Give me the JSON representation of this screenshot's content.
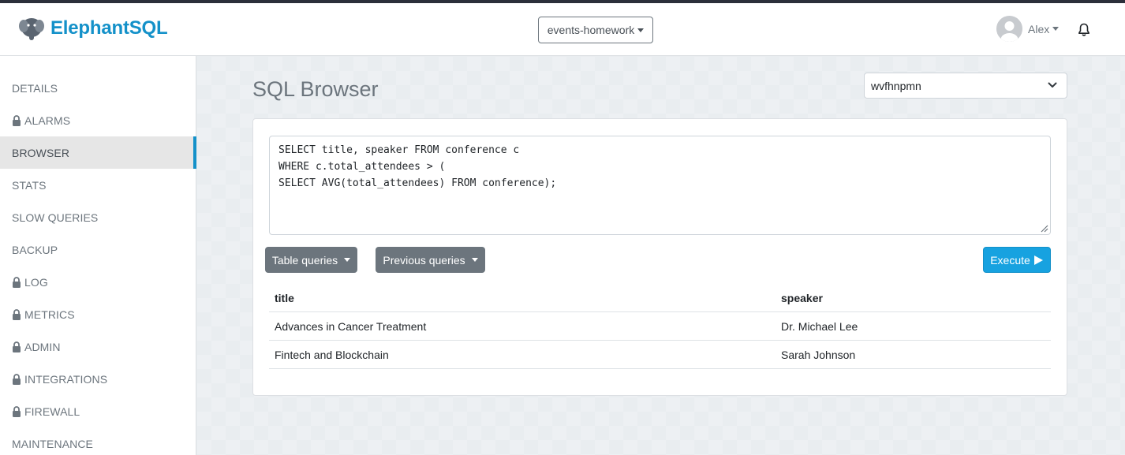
{
  "brand": {
    "name": "ElephantSQL"
  },
  "header": {
    "instance": "events-homework",
    "user": "Alex",
    "icons": [
      "elephant-logo-icon",
      "avatar-icon",
      "bell-icon"
    ]
  },
  "sidebar": {
    "items": [
      {
        "label": "DETAILS",
        "locked": false,
        "active": false
      },
      {
        "label": "ALARMS",
        "locked": true,
        "active": false
      },
      {
        "label": "BROWSER",
        "locked": false,
        "active": true
      },
      {
        "label": "STATS",
        "locked": false,
        "active": false
      },
      {
        "label": "SLOW QUERIES",
        "locked": false,
        "active": false
      },
      {
        "label": "BACKUP",
        "locked": false,
        "active": false
      },
      {
        "label": "LOG",
        "locked": true,
        "active": false
      },
      {
        "label": "METRICS",
        "locked": true,
        "active": false
      },
      {
        "label": "ADMIN",
        "locked": true,
        "active": false
      },
      {
        "label": "INTEGRATIONS",
        "locked": true,
        "active": false
      },
      {
        "label": "FIREWALL",
        "locked": true,
        "active": false
      },
      {
        "label": "MAINTENANCE",
        "locked": false,
        "active": false
      }
    ]
  },
  "main": {
    "title": "SQL Browser",
    "database": "wvfhnpmn",
    "query": "SELECT title, speaker FROM conference c\nWHERE c.total_attendees > (\nSELECT AVG(total_attendees) FROM conference);",
    "buttons": {
      "table_queries": "Table queries",
      "previous_queries": "Previous queries",
      "execute": "Execute"
    },
    "results": {
      "columns": [
        "title",
        "speaker"
      ],
      "rows": [
        [
          "Advances in Cancer Treatment",
          "Dr. Michael Lee"
        ],
        [
          "Fintech and Blockchain",
          "Sarah Johnson"
        ]
      ]
    }
  },
  "colors": {
    "brand": "#1491c9",
    "execute": "#17a2e0",
    "secondary": "#6c757d"
  }
}
